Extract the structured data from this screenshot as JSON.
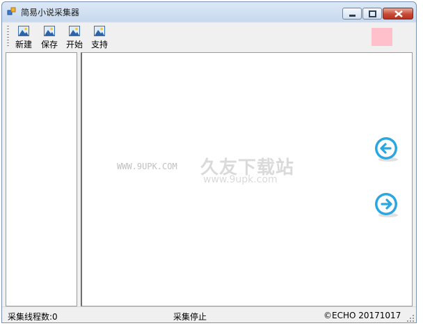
{
  "window": {
    "title": "简易小说采集器",
    "app_icon": "app-window-icon",
    "controls": {
      "minimize": "minimize-icon",
      "maximize": "maximize-icon",
      "close": "close-icon"
    }
  },
  "toolbar": {
    "buttons": [
      {
        "label": "新建",
        "icon": "image-icon"
      },
      {
        "label": "保存",
        "icon": "image-icon"
      },
      {
        "label": "开始",
        "icon": "image-icon"
      },
      {
        "label": "支持",
        "icon": "image-icon"
      }
    ],
    "swatch_color": "#ffc0cb"
  },
  "main": {
    "watermark_site": "久友下载站",
    "watermark_url": "WWW.9UPK.COM",
    "watermark_url2": "www.9upk.com",
    "prev_icon": "arrow-left-circle-icon",
    "next_icon": "arrow-right-circle-icon",
    "accent_color": "#2aa7e0"
  },
  "statusbar": {
    "threads": "采集线程数:0",
    "state": "采集停止",
    "copyright": "©ECHO 20171017"
  }
}
